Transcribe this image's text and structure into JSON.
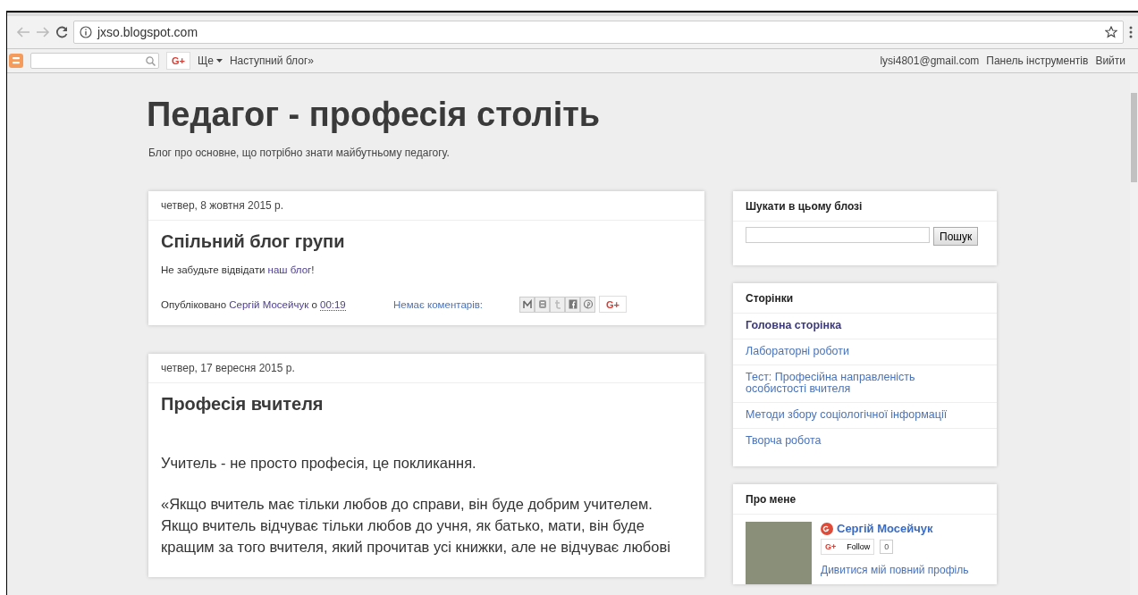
{
  "browser": {
    "url": "jxso.blogspot.com"
  },
  "navbar": {
    "gplus": "G+",
    "more": "Ще",
    "next_blog": "Наступний блог»",
    "email": "lysi4801@gmail.com",
    "dashboard": "Панель інструментів",
    "sign_out": "Вийти"
  },
  "blog": {
    "title": "Педагог - професія століть",
    "description": "Блог про основне, що потрібно знати майбутньому педагогу."
  },
  "posts": [
    {
      "kind": "note",
      "date": "четвер, 8 жовтня 2015 р.",
      "title": "Спільний блог групи",
      "paragraphs": [
        [
          {
            "text": "Не забудьте відвідати "
          },
          {
            "text": "наш блог",
            "link": true
          },
          {
            "text": "!"
          }
        ]
      ],
      "footer": {
        "byline": [
          {
            "text": "Опубліковано "
          },
          {
            "text": "Сергій Мосейчук",
            "link": true
          },
          {
            "text": " о "
          },
          {
            "text": "00:19",
            "link": true,
            "dotted": true
          }
        ],
        "comments": "Немає коментарів:",
        "share_gplus": "G+"
      }
    },
    {
      "kind": "article",
      "date": "четвер, 17 вересня 2015 р.",
      "title": "Професія вчителя",
      "paragraphs": [
        [
          {
            "text": "Учитель - не просто професія, це покликання."
          }
        ],
        [
          {
            "text": "«Якщо вчитель має тільки любов до справи, він буде добрим учителем. Якщо вчитель відчуває тільки любов до учня, як батько, мати, він буде кращим за того вчителя, який прочитав усі книжки, але не відчуває любові"
          }
        ]
      ]
    }
  ],
  "sidebar": {
    "search": {
      "title": "Шукати в цьому блозі",
      "button": "Пошук"
    },
    "pages": {
      "title": "Сторінки",
      "items": [
        {
          "label": "Головна сторінка",
          "selected": true
        },
        {
          "label": "Лабораторні роботи",
          "selected": false
        },
        {
          "label": "Тест: Професійна направленість особистості вчителя",
          "selected": false
        },
        {
          "label": "Методи збору соціологічної інформації",
          "selected": false
        },
        {
          "label": "Творча робота",
          "selected": false
        }
      ]
    },
    "profile": {
      "title": "Про мене",
      "name": "Сергій Мосейчук",
      "follow_icon": "G+",
      "follow": "Follow",
      "count": "0",
      "link": "Дивитися мій повний профіль"
    }
  }
}
